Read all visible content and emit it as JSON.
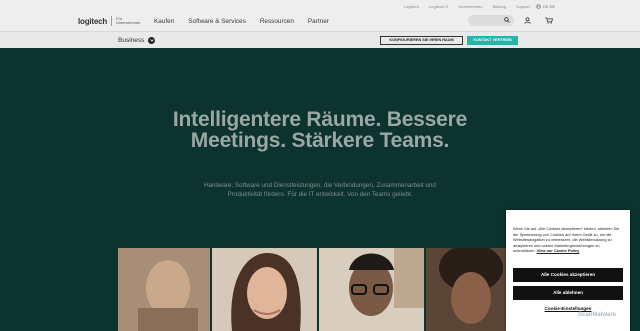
{
  "utility_nav": {
    "links": [
      "Logitech",
      "Logitech G",
      "Unternehmen",
      "Bildung",
      "Support"
    ],
    "locale": "DE DE"
  },
  "brand": {
    "logo_word": "logitech",
    "logo_sub_line1": "Für",
    "logo_sub_line2": "Unternehmen"
  },
  "main_nav": {
    "items": [
      "Kaufen",
      "Software & Services",
      "Ressourcen",
      "Partner"
    ]
  },
  "subbar": {
    "business_label": "Business",
    "configure_button": "KONFIGURIEREN SIE IHREN RAUM",
    "contact_button": "KONTAKT VERTRIEB"
  },
  "hero": {
    "title": "Intelligentere Räume. Bessere Meetings. Stärkere Teams.",
    "subtitle": "Hardware, Software und Dienstleistungen, die Verbindungen, Zusammenarbeit und Produktivität fördern. Für die IT entwickelt. Von den Teams geliebt."
  },
  "cookie_banner": {
    "text": "Wenn Sie auf „Alle Cookies akzeptieren“ klicken, stimmen Sie der Speicherung von Cookies auf Ihrem Gerät zu, um die Websitenavigation zu verbessern, die Websitenutzung zu analysieren und unsere Marketingbemühungen zu unterstützen.",
    "policy_link": "View our Cookie Policy",
    "accept_button": "Alle Cookies akzeptieren",
    "reject_button": "Alle ablehnen",
    "settings_button": "Cookie-Einstellungen"
  },
  "watermark": "ScanMalware",
  "colors": {
    "hero_bg": "#0c332d",
    "accent_teal": "#20b7a8",
    "nav_bg": "#eeeeee"
  }
}
